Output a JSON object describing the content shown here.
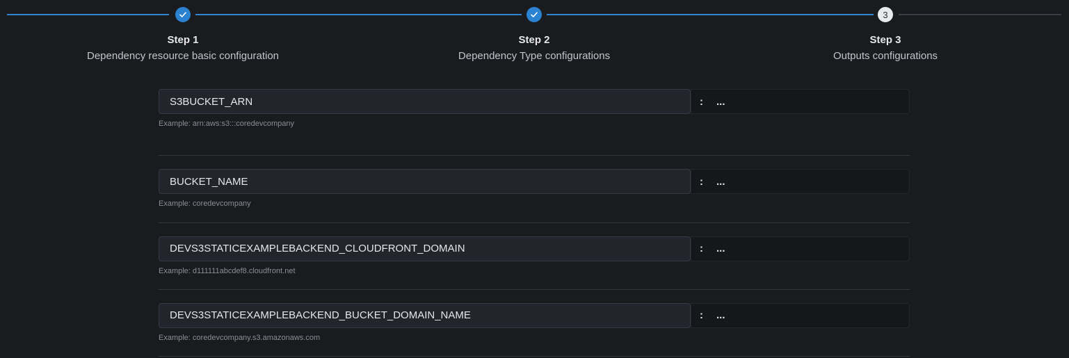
{
  "stepper": {
    "steps": [
      {
        "title": "Step 1",
        "description": "Dependency resource basic configuration",
        "status": "completed",
        "icon": "check-icon"
      },
      {
        "title": "Step 2",
        "description": "Dependency Type configurations",
        "status": "completed",
        "icon": "check-icon"
      },
      {
        "title": "Step 3",
        "description": "Outputs configurations",
        "status": "current",
        "number": "3"
      }
    ],
    "colors": {
      "active": "#2f86d3",
      "pending": "#3a3d45"
    }
  },
  "outputs": [
    {
      "key": "S3BUCKET_ARN",
      "separator": ":",
      "value": "...",
      "example": "Example: arn:aws:s3:::coredevcompany"
    },
    {
      "key": "BUCKET_NAME",
      "separator": ":",
      "value": "...",
      "example": "Example: coredevcompany"
    },
    {
      "key": "DEVS3STATICEXAMPLEBACKEND_CLOUDFRONT_DOMAIN",
      "separator": ":",
      "value": "...",
      "example": "Example: d111111abcdef8.cloudfront.net"
    },
    {
      "key": "DEVS3STATICEXAMPLEBACKEND_BUCKET_DOMAIN_NAME",
      "separator": ":",
      "value": "...",
      "example": "Example: coredevcompany.s3.amazonaws.com"
    }
  ]
}
